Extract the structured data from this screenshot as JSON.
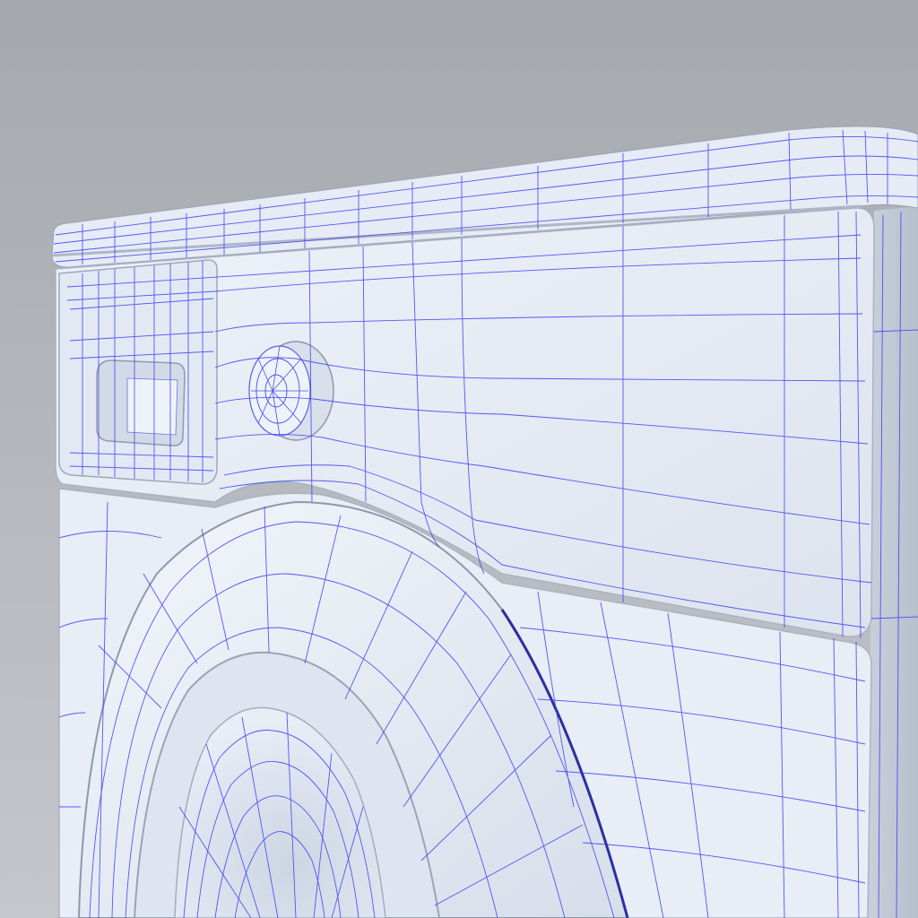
{
  "scene": {
    "subject": "washing-machine-wireframe-render",
    "colors": {
      "background_top": "#a5a9ad",
      "background_bottom": "#c4c7cb",
      "body": "#e9eef7",
      "body_shade": "#cfd6e4",
      "wire": "#3b3ff0"
    }
  }
}
